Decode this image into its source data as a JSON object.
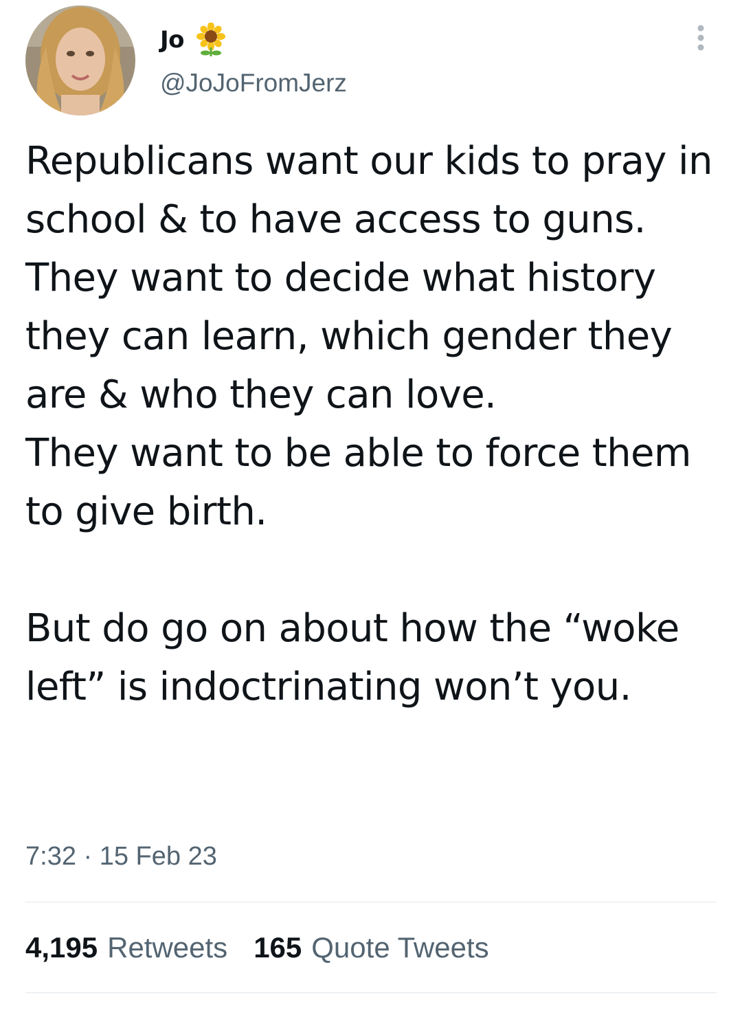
{
  "author": {
    "display_name": "Jo",
    "name_emoji": "sunflower-icon",
    "handle": "@JoJoFromJerz"
  },
  "tweet": {
    "text": "Republicans want our kids to pray in school & to have access to guns. They want to decide what history they can learn, which gender they are & who they can love.\nThey want to be able to force them to give birth.\n\nBut do go on about how the “woke left” is indoctrinating won’t you.",
    "timestamp": "7:32 · 15 Feb 23"
  },
  "stats": {
    "retweets_count": "4,195",
    "retweets_label": "Retweets",
    "quote_tweets_count": "165",
    "quote_tweets_label": "Quote Tweets"
  },
  "colors": {
    "text_primary": "#0f1419",
    "text_secondary": "#536471",
    "divider": "#e1e6ea",
    "sunflower_petal": "#f7c21a",
    "sunflower_center": "#8a4a16",
    "sunflower_stem": "#5fae3b"
  }
}
